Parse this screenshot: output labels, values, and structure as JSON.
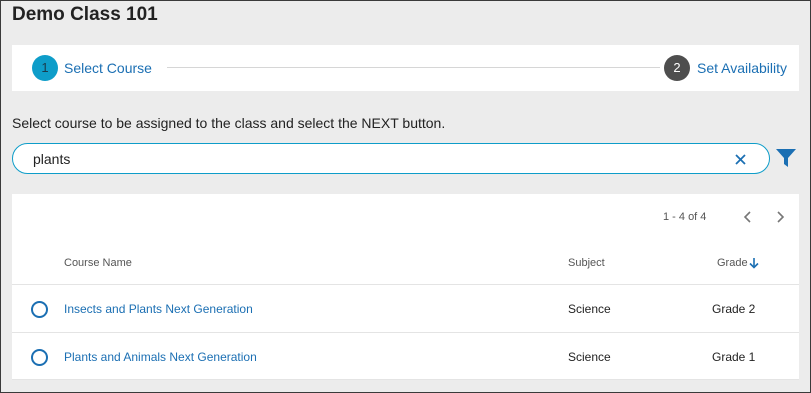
{
  "header": {
    "class_title": "Demo Class 101"
  },
  "stepper": {
    "steps": [
      {
        "number": "1",
        "label": "Select Course",
        "state": "active"
      },
      {
        "number": "2",
        "label": "Set Availability",
        "state": "inactive"
      }
    ]
  },
  "instructions": "Select course to be assigned to the class and select the NEXT button.",
  "search": {
    "value": "plants",
    "clear_icon": "close-icon",
    "filter_icon": "filter-icon"
  },
  "pagination": {
    "range_text": "1 - 4 of 4"
  },
  "table": {
    "columns": {
      "course_name": "Course Name",
      "subject": "Subject",
      "grade": "Grade"
    },
    "sort": {
      "column": "Grade",
      "direction": "descending"
    },
    "rows": [
      {
        "course_name": "Insects and Plants Next Generation",
        "subject": "Science",
        "grade": "Grade 2"
      },
      {
        "course_name": "Plants and Animals Next Generation",
        "subject": "Science",
        "grade": "Grade 1"
      }
    ]
  },
  "colors": {
    "accent": "#0e9dc9",
    "link": "#1b6fb3",
    "inactive_step": "#4e4e4e",
    "background": "#ececec"
  }
}
